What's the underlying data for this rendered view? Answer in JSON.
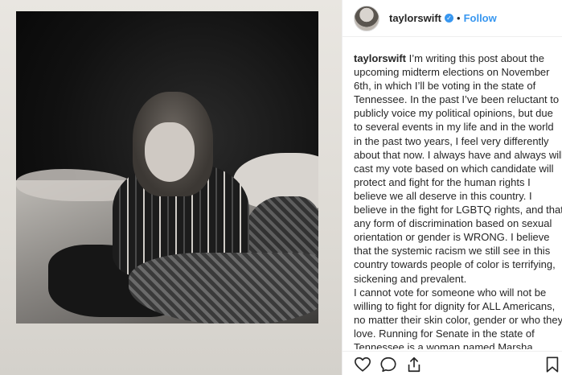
{
  "post": {
    "author": {
      "username": "taylorswift",
      "verified_mark": "✓",
      "separator": "•",
      "follow_label": "Follow"
    },
    "caption": {
      "username": "taylorswift",
      "paragraphs": [
        "I’m writing this post about the upcoming midterm elections on November 6th, in which I’ll be voting in the state of Tennessee. In the past I’ve been reluctant to publicly voice my political opinions, but due to several events in my life and in the world in the past two years, I feel very differently about that now. I always have and always will cast my vote based on which candidate will protect and fight for the human rights I believe we all deserve in this country. I believe in the fight for LGBTQ rights, and that any form of discrimination based on sexual orientation or gender is WRONG. I believe that the systemic racism we still see in this country towards people of color is terrifying, sickening and prevalent.",
        "I cannot vote for someone who will not be willing to fight for dignity for ALL Americans, no matter their skin color, gender or who they love. Running for Senate in the state of Tennessee is a woman named Marsha Blackburn. As much as I have in the past and would like to continue voting for women"
      ]
    },
    "actions": {
      "like_icon": "heart-icon",
      "comment_icon": "comment-icon",
      "share_icon": "share-icon",
      "save_icon": "bookmark-icon"
    },
    "colors": {
      "link_blue": "#3897f0",
      "text": "#262626",
      "divider": "#efefef"
    }
  }
}
